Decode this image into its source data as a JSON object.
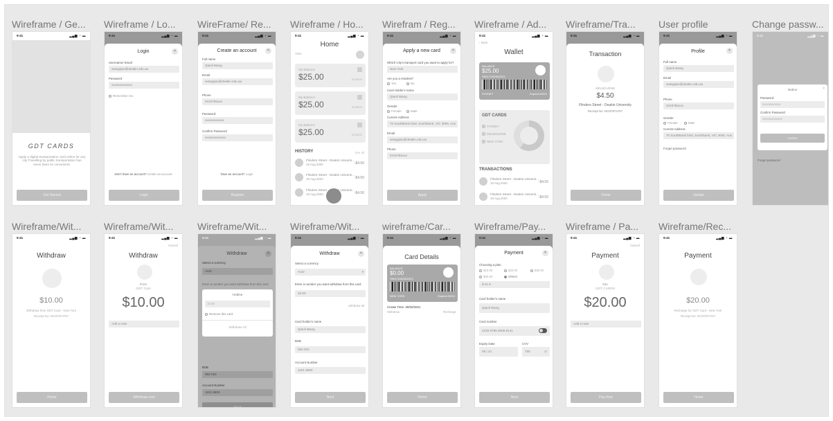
{
  "status": {
    "time": "9:41",
    "icons": "▂▄▆ ◔ ▬"
  },
  "frames_row1": [
    "Wireframe / Ge...",
    "Wireframe / Lo...",
    "WireFrame/ Re...",
    "Wireframe / Ho...",
    "Wirefram / Reg...",
    "Wireframe / Ad...",
    "Wireframe/Tra...",
    "User profile",
    "Change passw..."
  ],
  "frames_row2": [
    "Wireframe/Wit...",
    "Wireframe/Wit...",
    "Wireframe/Wit...",
    "Wireframe/Wit...",
    "wireframe/Car...",
    "Wireframe/Pay...",
    "Wireframe / Pa...",
    "Wireframe/Rec..."
  ],
  "getstarted": {
    "brand": "GDT CARDS",
    "desc": "Apply a digital transportation card online for any city Travelling by public transportation has never been so convenient.",
    "button": "Get Started"
  },
  "login": {
    "title": "Login",
    "user_label": "Username/ Email",
    "user_value": "wangqiao@deakin.edu.au",
    "pass_label": "Password",
    "pass_value": "xxxxxxxxxxxxx",
    "remember": "Remember me.",
    "no_account": "Don't have an account?",
    "create_link": "Create an account",
    "button": "Login"
  },
  "register": {
    "title": "Create an account",
    "fields": [
      {
        "label": "Full name",
        "value": "Qiaoli Wang"
      },
      {
        "label": "Email",
        "value": "wangqiao@deakin.edu.au"
      },
      {
        "label": "Phone",
        "value": "04157Bxxxx"
      },
      {
        "label": "Password",
        "value": "xxxxxxxxxxxx"
      },
      {
        "label": "Confirm Password",
        "value": "xxxxxxxxxxxxx"
      }
    ],
    "have_account": "have an account?",
    "login_link": "Login",
    "button": "Register"
  },
  "home": {
    "title": "Home",
    "subtitle": "Yoko",
    "cards": [
      {
        "label": "My Balance",
        "amount": "$25.00",
        "loc": "location"
      },
      {
        "label": "My Balance",
        "amount": "$25.00",
        "loc": "location"
      },
      {
        "label": "My Balance",
        "amount": "$25.00",
        "loc": "location"
      }
    ],
    "history_title": "HISTORY",
    "see_all": "See all",
    "history": [
      {
        "title": "Flinders Street - Deakin Universi...",
        "date": "15 Aug 2020",
        "amount": "-$4.50"
      },
      {
        "title": "Flinders Street - Deakin Universi...",
        "date": "15 Aug 2020",
        "amount": "-$4.50"
      },
      {
        "title": "Flinders Street - Deakin Universi...",
        "date": "15 Aug 2020",
        "amount": "-$4.50"
      }
    ]
  },
  "apply": {
    "title": "Apply a new card",
    "q1": "Which City's transport card you want to apply for?",
    "city": "New York",
    "q2": "Are you a resident?",
    "yes": "Yes",
    "no": "No",
    "holder_label": "Card Holder's name",
    "holder": "Qiaoli Wang",
    "gender_label": "Gender",
    "female": "Female",
    "male": "Male",
    "addr_label": "Current Address",
    "addr": "70 SouthBank blvd, Southbank, VIC 3006, Aus",
    "email_label": "Email",
    "email": "wangqiao@deakin.edu.au",
    "phone_label": "Phone",
    "phone": "04157Bxxxx",
    "button": "Apply"
  },
  "wallet": {
    "back": "Back",
    "title": "Wallet",
    "balance_label": "BALANCE",
    "balance": "$25.00",
    "card_number": "SN01726DN02323",
    "city": "SYDNEY",
    "expiry": "Expired 09/24",
    "cards_title": "GDT CARDS",
    "cities": [
      "SYDNEY",
      "MELBOURNE",
      "NEW YORK"
    ],
    "tx_title": "TRANSACTIONS",
    "tx": [
      {
        "title": "Flinders Street - Deakin Universi...",
        "date": "15 Aug 2020",
        "amount": "-$4.50"
      },
      {
        "title": "Flinders Street - Deakin Universi...",
        "date": "15 Aug 2020",
        "amount": "-$4.50"
      }
    ]
  },
  "transaction": {
    "title": "Transaction",
    "city": "MELBOURNE",
    "amount": "$4.50",
    "route": "Flinders Street - Deakin University",
    "receipt": "Receipt No: NO37874767",
    "button": "Home"
  },
  "profile": {
    "title": "Profile",
    "name_label": "Full name",
    "name": "Qiaoli Wang",
    "email_label": "Email",
    "email": "wangqiao@deakin.edu.au",
    "phone_label": "Phone",
    "phone": "04157Bxxxx",
    "gender_label": "Gender",
    "female": "Female",
    "male": "Male",
    "addr_label": "Current Address",
    "addr": "70 SouthBank blvd, Southbank, VIC 3006, Aus",
    "forget": "Forget password",
    "button": "Update"
  },
  "changepass": {
    "notice": "Notice",
    "pass_label": "Password",
    "pass_value": "xxxxxxxxxxxx",
    "confirm_label": "Confirm Password",
    "confirm_value": "xxxxxxxxxxxxx",
    "button": "Update",
    "forget": "Forget password"
  },
  "withdraw1": {
    "title": "Withdraw",
    "amount": "$10.00",
    "desc": "Withdraw from GDT Card - New York",
    "receipt": "Receipt No: NO37874767",
    "button": "Home"
  },
  "withdraw2": {
    "cancel": "Cancel",
    "title": "Withdraw",
    "from_label": "From",
    "from": "GDT Cars",
    "amount": "$10.00",
    "note": "Add a note",
    "button": "Withdraw now"
  },
  "withdraw3": {
    "title": "Withdraw",
    "currency_label": "Select a currency",
    "currency": "AUD",
    "prompt": "Enter a number you want withdraw from this card",
    "dialog_title": "Hotline",
    "dialog_value": "10.00",
    "remove": "Remove this card",
    "withdraw_all": "Withdraw All",
    "bsb_label": "BSB",
    "bsb": "063 010",
    "account_label": "Account Number",
    "account": "1101 8900",
    "button": "Next"
  },
  "withdraw4": {
    "title": "Withdraw",
    "currency_label": "Select a currency",
    "currency": "AUD",
    "prompt": "Enter a number you want withdraw from this card",
    "value": "10.00",
    "withdraw_all": "withdraw all",
    "holder_label": "Card holder's name",
    "holder": "Qiaoli Wang",
    "bsb_label": "BSB",
    "bsb": "063 010",
    "account_label": "Account Number",
    "account": "1101 8900",
    "button": "Next"
  },
  "carddetails": {
    "title": "Card Details",
    "balance_label": "BALANCE",
    "balance": "$0.00",
    "card_number": "SN01726DN02323",
    "city": "NEW YORK",
    "expiry": "Expired 09/24",
    "created": "Create Time: 30/02/2021",
    "withdraw": "Withdraw",
    "recharge": "Recharge",
    "button": "Home"
  },
  "payment1": {
    "title": "Payment",
    "plan_label": "Choosing a plan",
    "plans": [
      "$10.00",
      "$20.00",
      "$30.00",
      "$50.00",
      "Others"
    ],
    "custom": "$ 21.6",
    "holder_label": "Card holder's name",
    "holder": "Qiaoli Wang",
    "number_label": "Card number",
    "number": "4225 8765 0008 8141",
    "expiry_label": "Expiry Date",
    "expiry": "09 | 24",
    "cvv_label": "CVV",
    "cvv": "755",
    "button": "Next"
  },
  "payment2": {
    "cancel": "Cancel",
    "title": "Payment",
    "to_label": "Into",
    "to": "GDT CARDS",
    "amount": "$20.00",
    "note": "Add a note",
    "button": "Pay Now"
  },
  "receipt": {
    "title": "Payment",
    "amount": "$20.00",
    "desc": "Recharge for GDT Card - New York",
    "receipt": "Receipt No: NO37874767",
    "button": "Home"
  }
}
